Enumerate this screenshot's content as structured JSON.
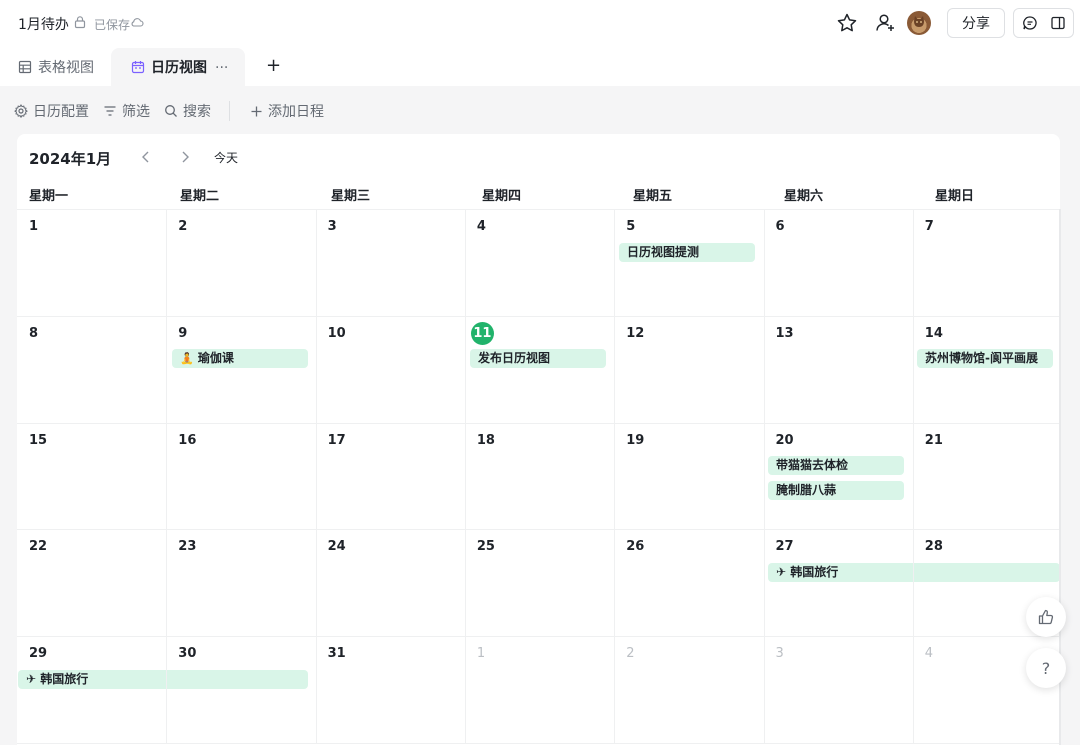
{
  "header": {
    "title": "1月待办",
    "saved_status": "已保存",
    "share_label": "分享"
  },
  "tabs": [
    {
      "label": "表格视图"
    },
    {
      "label": "日历视图",
      "more": "···"
    }
  ],
  "tab_add": "+",
  "toolbar": {
    "calendar_config": "日历配置",
    "filter": "筛选",
    "search": "搜索",
    "add_schedule": "添加日程"
  },
  "calendar": {
    "month_title": "2024年1月",
    "today_label": "今天",
    "weekdays": [
      "星期一",
      "星期二",
      "星期三",
      "星期四",
      "星期五",
      "星期六",
      "星期日"
    ],
    "weeks": [
      [
        "1",
        "2",
        "3",
        "4",
        "5",
        "6",
        "7"
      ],
      [
        "8",
        "9",
        "10",
        "11",
        "12",
        "13",
        "14"
      ],
      [
        "15",
        "16",
        "17",
        "18",
        "19",
        "20",
        "21"
      ],
      [
        "22",
        "23",
        "24",
        "25",
        "26",
        "27",
        "28"
      ],
      [
        "29",
        "30",
        "31",
        "1",
        "2",
        "3",
        "4"
      ]
    ],
    "today": "11",
    "events": {
      "jan5": "日历视图提测",
      "jan9": "瑜伽课",
      "jan11": "发布日历视图",
      "jan14": "苏州博物馆-阆平画展",
      "jan20a": "带猫猫去体检",
      "jan20b": "腌制腊八蒜",
      "trip_a": "韩国旅行",
      "trip_b": "韩国旅行"
    },
    "event_icons": {
      "jan9": "yoga-icon",
      "trip": "airplane-icon"
    }
  },
  "float_help": "?",
  "colors": {
    "accent": "#21b36b",
    "event_bg": "#d9f5e8"
  }
}
